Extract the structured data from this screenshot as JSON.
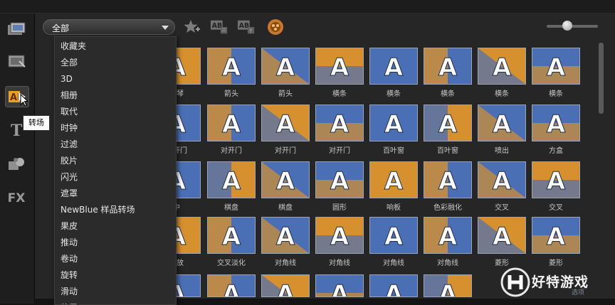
{
  "category_select": {
    "value": "全部"
  },
  "toolbar": {
    "icons": [
      "favorite-add-icon",
      "apply-to-all-icon",
      "apply-random-icon",
      "options-icon"
    ]
  },
  "sidebar": {
    "items": [
      {
        "icon": "media-icon"
      },
      {
        "icon": "instant-project-icon"
      },
      {
        "icon": "transition-icon",
        "active": true,
        "tooltip": "转场"
      },
      {
        "icon": "title-icon"
      },
      {
        "icon": "graphics-icon"
      },
      {
        "icon": "fx-icon",
        "text": "FX"
      }
    ]
  },
  "dropdown": {
    "items": [
      "收藏夹",
      "全部",
      "3D",
      "相册",
      "取代",
      "时钟",
      "过滤",
      "胶片",
      "闪光",
      "遮罩",
      "NewBlue 样品转场",
      "果皮",
      "推动",
      "卷动",
      "旋转",
      "滑动",
      "伸展"
    ]
  },
  "transitions": {
    "rows": [
      [
        "风琴",
        "箭头",
        "箭头",
        "横条",
        "横条",
        "横条",
        "横条",
        "横条"
      ],
      [
        "对开门",
        "对开门",
        "对开门",
        "对开门",
        "百叶窗",
        "百叶窗",
        "喷出",
        "方盒"
      ],
      [
        "中",
        "棋盘",
        "棋盘",
        "圆形",
        "响板",
        "色彩融化",
        "交叉",
        "交叉"
      ],
      [
        "缩放",
        "交叉淡化",
        "对角线",
        "对角线",
        "对角线",
        "对角线",
        "菱形",
        "菱形"
      ]
    ]
  },
  "watermark": {
    "text": "好特游戏",
    "sub": "选项"
  },
  "colors": {
    "thumb_blue": "#4a6fb5",
    "thumb_orange": "#d7902e",
    "background": "#262626"
  }
}
